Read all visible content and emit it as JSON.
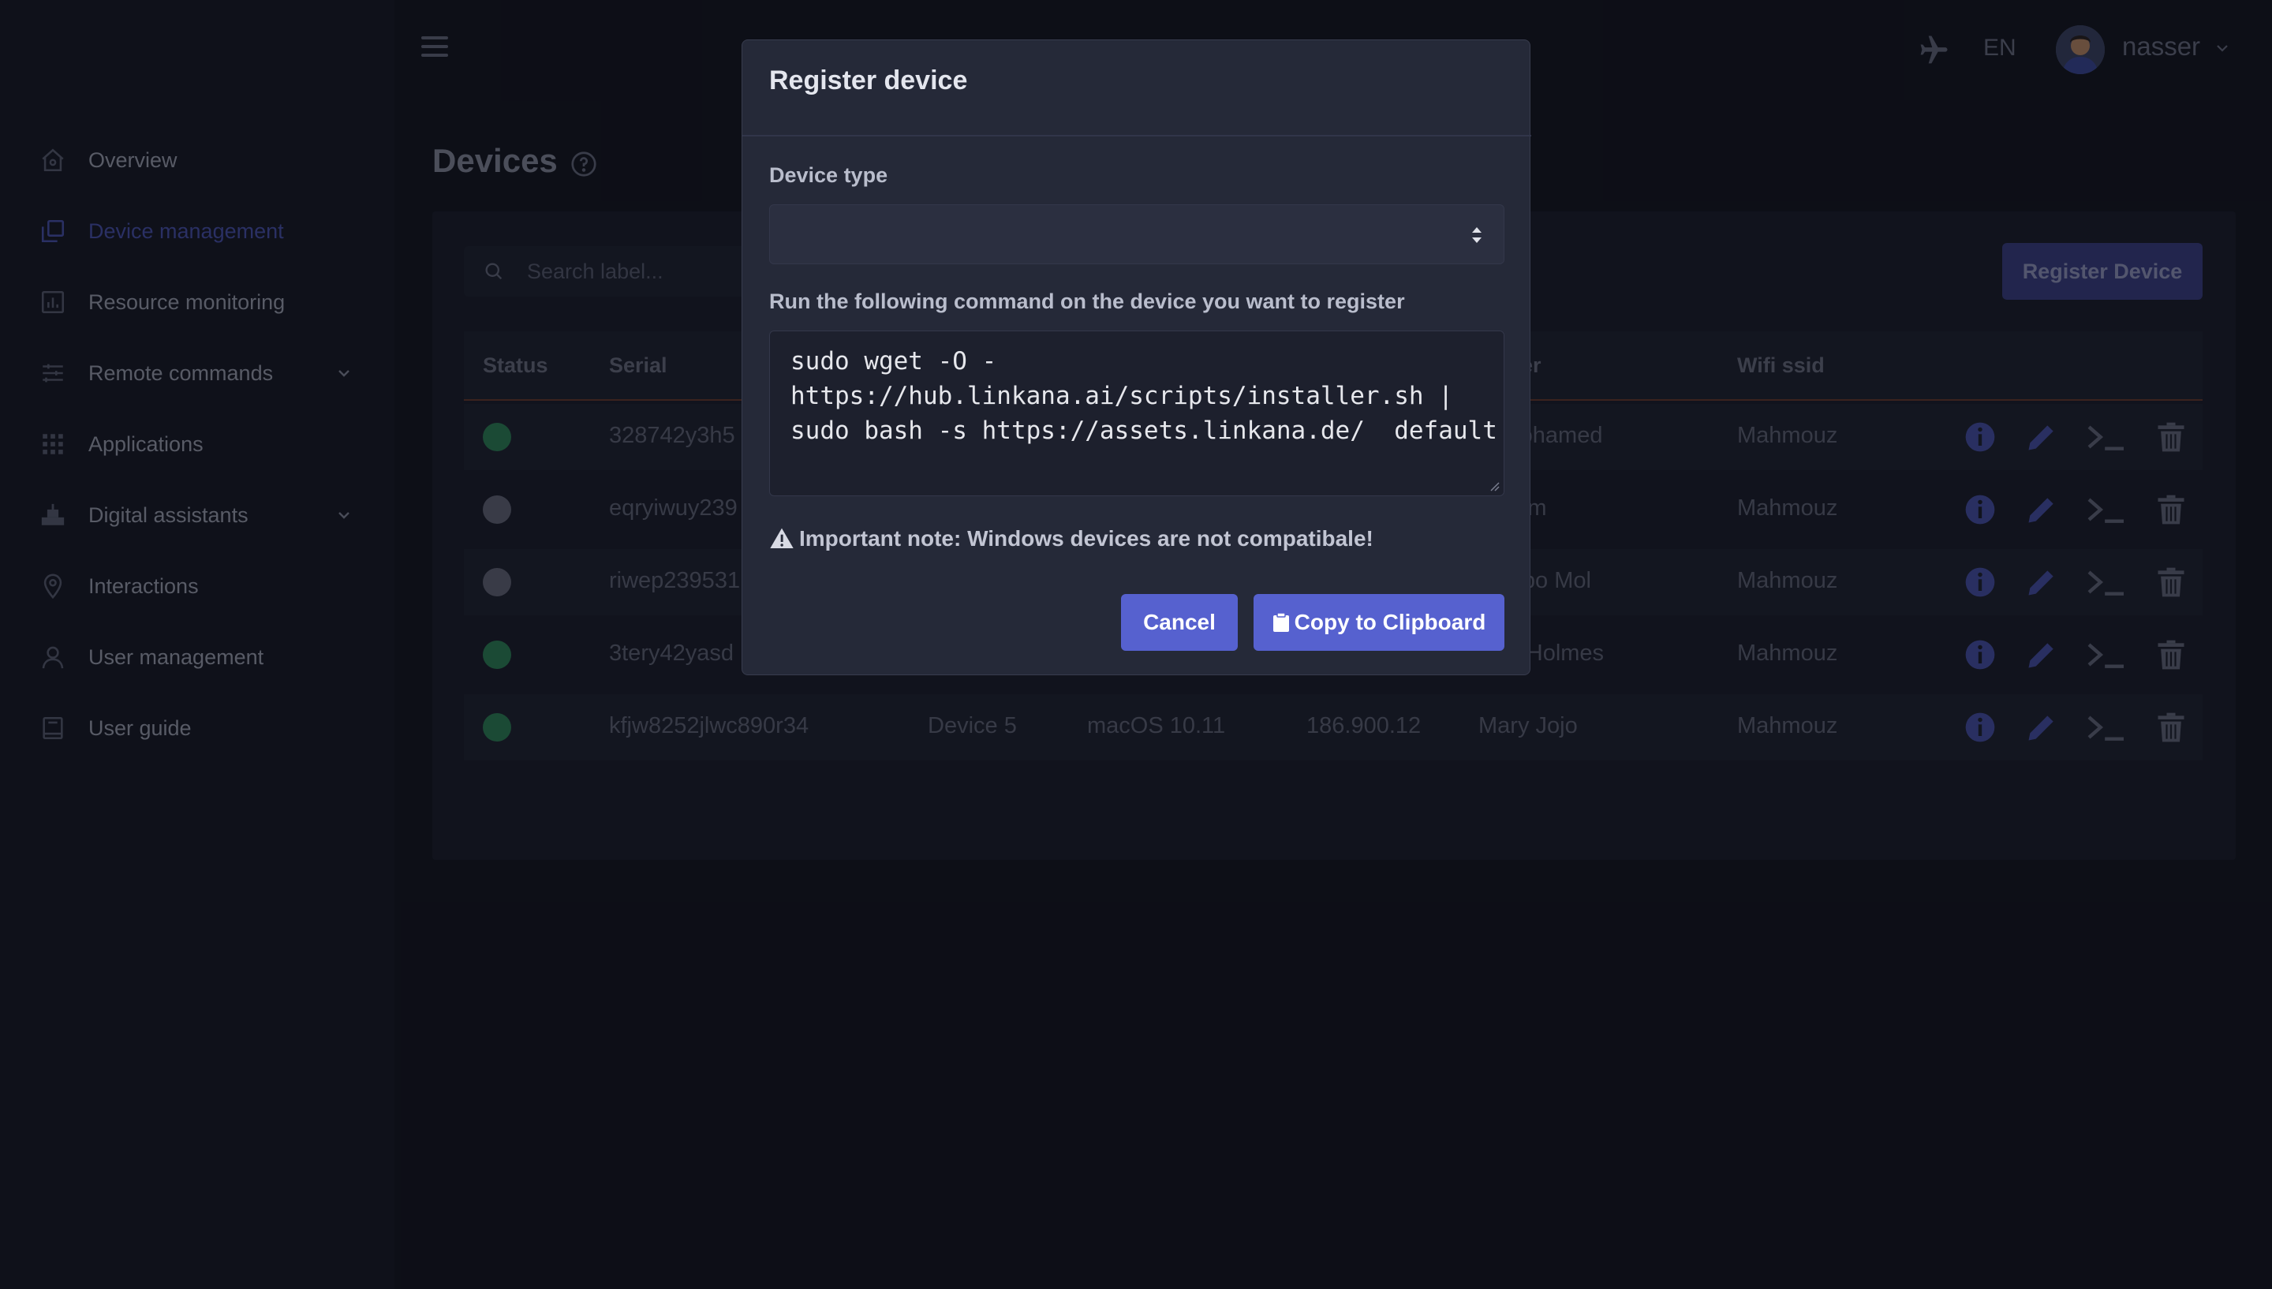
{
  "colors": {
    "accent": "#5661cf",
    "status_online": "#2f8a5a",
    "status_offline": "#6a6d7e",
    "active_nav": "#4d56b8",
    "table_header_border": "#6e3a2c"
  },
  "sidebar": {
    "items": [
      {
        "label": "Overview",
        "icon": "home-icon"
      },
      {
        "label": "Device management",
        "icon": "devices-icon",
        "active": true
      },
      {
        "label": "Resource monitoring",
        "icon": "chart-icon"
      },
      {
        "label": "Remote commands",
        "icon": "sliders-icon",
        "expandable": true
      },
      {
        "label": "Applications",
        "icon": "grid-icon"
      },
      {
        "label": "Digital assistants",
        "icon": "robot-icon",
        "expandable": true
      },
      {
        "label": "Interactions",
        "icon": "location-pin-icon"
      },
      {
        "label": "User management",
        "icon": "user-icon"
      },
      {
        "label": "User guide",
        "icon": "book-icon"
      }
    ]
  },
  "topbar": {
    "menu_icon": "hamburger-icon",
    "mode_icon": "airplane-icon",
    "language": "EN",
    "username": "nasser"
  },
  "page": {
    "title": "Devices",
    "help_icon": "question-circle-icon"
  },
  "toolbar": {
    "search_placeholder": "Search label...",
    "register_button": "Register Device"
  },
  "table": {
    "columns": {
      "status": "Status",
      "serial": "Serial",
      "user": "er",
      "wifi": "Wifi ssid"
    },
    "rows": [
      {
        "status": "online",
        "serial": "328742y3h5",
        "label": "",
        "os": "",
        "ip": "",
        "user": "l Mohamed",
        "wifi": "Mahmouz"
      },
      {
        "status": "offline",
        "serial": "eqryiwuy239",
        "label": "",
        "os": "",
        "ip": "",
        "user": "Leem",
        "wifi": "Mahmouz"
      },
      {
        "status": "offline",
        "serial": "riwep239531",
        "label": "",
        "os": "",
        "ip": "",
        "user": "a Abo Mol",
        "wifi": "Mahmouz"
      },
      {
        "status": "online",
        "serial": "3tery42yasd",
        "label": "",
        "os": "",
        "ip": "",
        "user": "hel Holmes",
        "wifi": "Mahmouz"
      },
      {
        "status": "online",
        "serial": "kfjw8252jlwc890r34",
        "label": "Device 5",
        "os": "macOS 10.11",
        "ip": "186.900.12",
        "user": "Mary Jojo",
        "wifi": "Mahmouz"
      }
    ],
    "row_actions": [
      "info-icon",
      "pencil-icon",
      "terminal-icon",
      "trash-icon"
    ]
  },
  "modal": {
    "title": "Register device",
    "device_type_label": "Device type",
    "device_type_value": "",
    "command_label": "Run the following command on the device you want to register",
    "command": "sudo wget -O -\nhttps://hub.linkana.ai/scripts/installer.sh |\nsudo bash -s https://assets.linkana.de/  default",
    "note": "Important note: Windows devices are not compatibale!",
    "cancel_label": "Cancel",
    "copy_label": "Copy to Clipboard"
  }
}
